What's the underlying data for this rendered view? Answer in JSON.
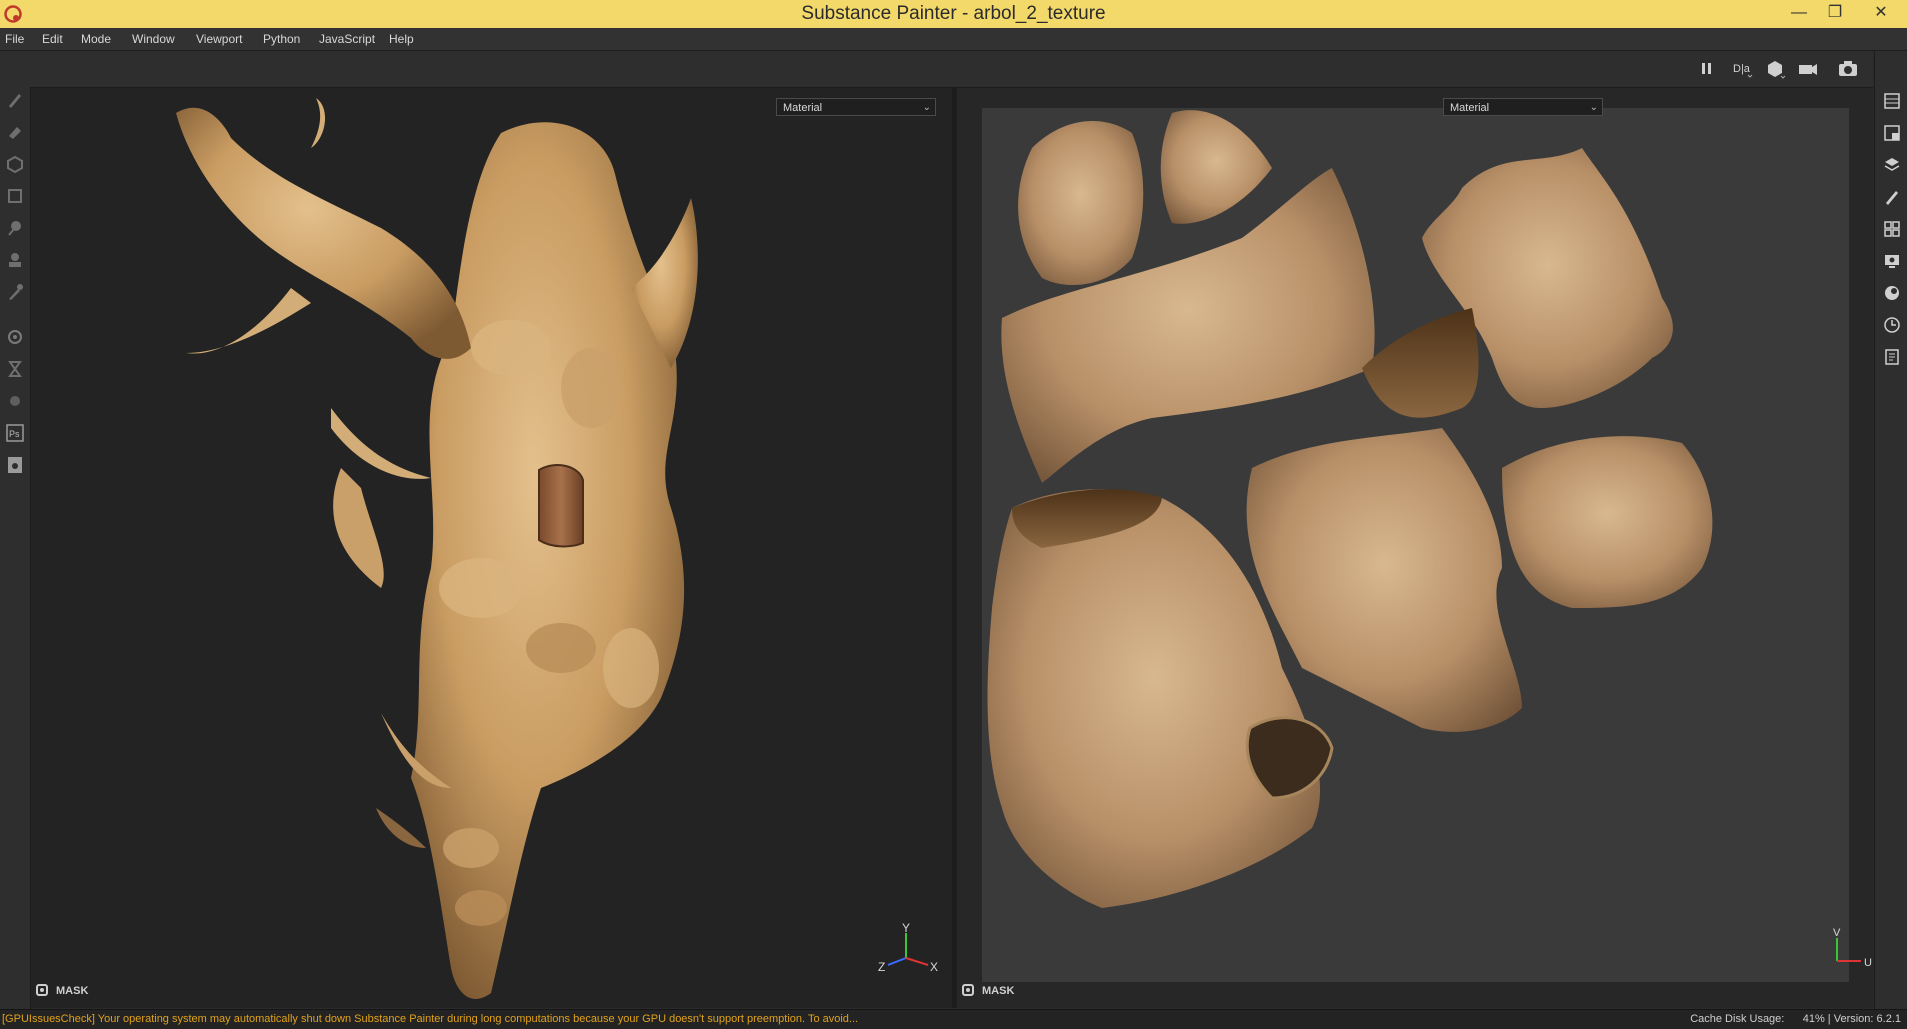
{
  "window": {
    "title": "Substance Painter - arbol_2_texture",
    "minimize_glyph": "—",
    "restore_glyph": "❐",
    "close_glyph": "✕"
  },
  "menu": [
    "File",
    "Edit",
    "Mode",
    "Window",
    "Viewport",
    "Python",
    "JavaScript",
    "Help"
  ],
  "toolbar": {
    "icons": [
      "pause-icon",
      "split-view-icon",
      "cube-icon",
      "camera-icon",
      "screenshot-icon"
    ]
  },
  "left_tools": [
    "brush-icon",
    "eraser-icon",
    "projection-icon",
    "polygon-fill-icon",
    "smudge-icon",
    "clone-icon",
    "picker-icon",
    "bake-icon",
    "hourglass-icon",
    "sphere-icon",
    "photoshop-icon",
    "export-icon"
  ],
  "right_tools": [
    "texture-set-list-icon",
    "texture-set-settings-icon",
    "layers-icon",
    "properties-icon",
    "shelf-icon",
    "display-settings-icon",
    "viewer-settings-icon",
    "history-icon",
    "log-icon"
  ],
  "viewport_3d": {
    "channel_select": "Material",
    "mask_label": "MASK",
    "axes": {
      "y": "Y",
      "z": "Z",
      "x": "X"
    }
  },
  "viewport_2d": {
    "channel_select": "Material",
    "mask_label": "MASK",
    "axes": {
      "v": "V",
      "u": "U"
    }
  },
  "status": {
    "message": "[GPUIssuesCheck] Your operating system may automatically shut down Substance Painter during long computations because your GPU doesn't support preemption. To avoid...",
    "cache_label": "Cache Disk Usage:",
    "cache_value": "41%",
    "version": "Version: 6.2.1"
  },
  "colors": {
    "titlebar": "#f2d96a",
    "status_warning": "#e0a21b",
    "wood_light": "#d9b47e",
    "wood_dark": "#8a6640"
  }
}
